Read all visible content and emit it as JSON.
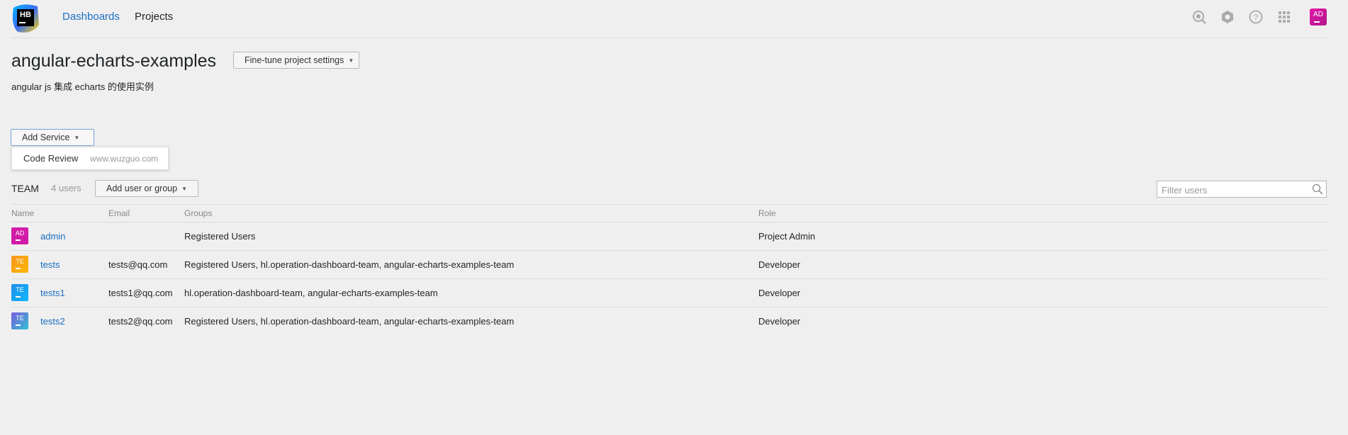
{
  "header": {
    "logo_text": "HB",
    "nav": [
      {
        "label": "Dashboards"
      },
      {
        "label": "Projects"
      }
    ],
    "user_avatar": "AD",
    "icons": [
      "search-icon",
      "gear-icon",
      "help-icon",
      "apps-grid-icon"
    ]
  },
  "project": {
    "title": "angular-echarts-examples",
    "settings_button": "Fine-tune project settings",
    "description": "angular js 集成 echarts 的使用实例"
  },
  "services": {
    "add_button": "Add Service",
    "dropdown_item": {
      "label": "Code Review",
      "hint": "www.wuzguo.com"
    }
  },
  "team": {
    "title": "TEAM",
    "count": "4 users",
    "add_button": "Add user or group",
    "filter_placeholder": "Filter users",
    "columns": {
      "name": "Name",
      "email": "Email",
      "groups": "Groups",
      "role": "Role"
    },
    "rows": [
      {
        "avatar": "AD",
        "avatar_color": "#d11ba8",
        "name": "admin",
        "email": "",
        "groups": "Registered Users",
        "role": "Project Admin"
      },
      {
        "avatar": "TE",
        "avatar_color": "#f7941d",
        "name": "tests",
        "email": "tests@qq.com",
        "groups": "Registered Users, hl.operation-dashboard-team, angular-echarts-examples-team",
        "role": "Developer"
      },
      {
        "avatar": "TE",
        "avatar_color": "#1f8fe6",
        "name": "tests1",
        "email": "tests1@qq.com",
        "groups": "hl.operation-dashboard-team, angular-echarts-examples-team",
        "role": "Developer"
      },
      {
        "avatar": "TE",
        "avatar_color": "#7a5cdc",
        "name": "tests2",
        "email": "tests2@qq.com",
        "groups": "Registered Users, hl.operation-dashboard-team, angular-echarts-examples-team",
        "role": "Developer"
      }
    ]
  },
  "colors": {
    "accent": "#1a6fc4",
    "background": "#efefef"
  }
}
